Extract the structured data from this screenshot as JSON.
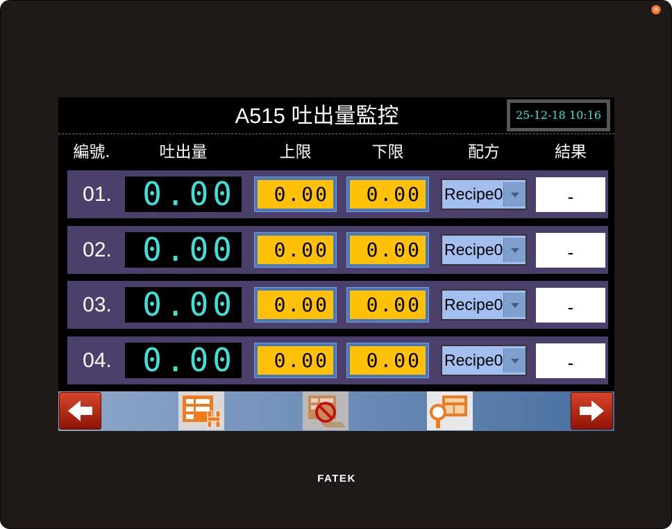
{
  "brand": "FATEK",
  "screen": {
    "title": "A515 吐出量監控",
    "datetime": "25-12-18 10:16"
  },
  "headers": {
    "no": "編號.",
    "output": "吐出量",
    "upper": "上限",
    "lower": "下限",
    "recipe": "配方",
    "result": "結果"
  },
  "rows": [
    {
      "no": "01.",
      "output": "0.00",
      "upper": "0.00",
      "lower": "0.00",
      "recipe": "Recipe0",
      "result": "-"
    },
    {
      "no": "02.",
      "output": "0.00",
      "upper": "0.00",
      "lower": "0.00",
      "recipe": "Recipe0",
      "result": "-"
    },
    {
      "no": "03.",
      "output": "0.00",
      "upper": "0.00",
      "lower": "0.00",
      "recipe": "Recipe0",
      "result": "-"
    },
    {
      "no": "04.",
      "output": "0.00",
      "upper": "0.00",
      "lower": "0.00",
      "recipe": "Recipe0",
      "result": "-"
    }
  ],
  "navbar": {
    "icons": [
      "arrow-left-icon",
      "table-edit-icon",
      "table-disabled-icon",
      "search-inspect-icon",
      "arrow-right-icon"
    ]
  },
  "colors": {
    "lcd_text": "#3fe0d8",
    "limit_fill": "#ffc107",
    "row_bg": "#4b3f6b",
    "recipe_bg": "#a2bff0"
  }
}
